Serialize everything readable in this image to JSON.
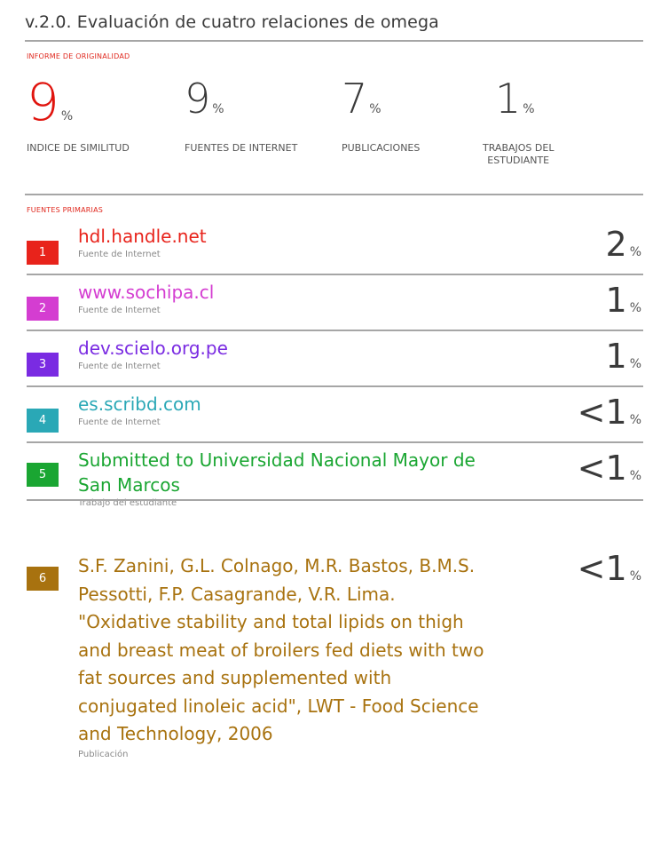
{
  "title": "v.2.0. Evaluación de cuatro relaciones de omega",
  "report_label": "INFORME DE ORIGINALIDAD",
  "stats": [
    {
      "value": "9",
      "unit": "%",
      "label": "INDICE DE SIMILITUD"
    },
    {
      "value": "9",
      "unit": "%",
      "label": "FUENTES DE INTERNET"
    },
    {
      "value": "7",
      "unit": "%",
      "label": "PUBLICACIONES"
    },
    {
      "value": "1",
      "unit": "%",
      "label": "TRABAJOS DEL\nESTUDIANTE"
    }
  ],
  "primary_label": "FUENTES PRIMARIAS",
  "sources": [
    {
      "rank": "1",
      "title": "hdl.handle.net",
      "type": "Fuente de Internet",
      "percent": "2",
      "unit": "%",
      "color": "#e8231b"
    },
    {
      "rank": "2",
      "title": "www.sochipa.cl",
      "type": "Fuente de Internet",
      "percent": "1",
      "unit": "%",
      "color": "#d43dd1"
    },
    {
      "rank": "3",
      "title": "dev.scielo.org.pe",
      "type": "Fuente de Internet",
      "percent": "1",
      "unit": "%",
      "color": "#7a2be2"
    },
    {
      "rank": "4",
      "title": "es.scribd.com",
      "type": "Fuente de Internet",
      "percent": "<1",
      "unit": "%",
      "color": "#2aa8b6"
    },
    {
      "rank": "5",
      "title": "Submitted to Universidad Nacional Mayor de\nSan Marcos",
      "type": "Trabajo del estudiante",
      "percent": "<1",
      "unit": "%",
      "color": "#1aa632"
    },
    {
      "rank": "6",
      "title": "S.F. Zanini, G.L. Colnago, M.R. Bastos, B.M.S.\nPessotti, F.P. Casagrande, V.R. Lima.\n\"Oxidative stability and total lipids on thigh\nand breast meat of broilers fed diets with two\nfat sources and supplemented with\nconjugated linoleic acid\", LWT - Food Science\nand Technology, 2006",
      "type": "Publicación",
      "percent": "<1",
      "unit": "%",
      "color": "#a8720f"
    }
  ]
}
